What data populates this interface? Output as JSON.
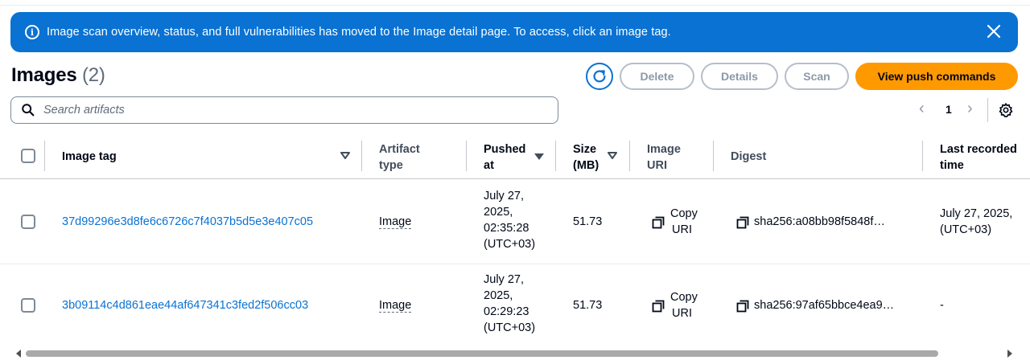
{
  "banner": {
    "message": "Image scan overview, status, and full vulnerabilities has moved to the Image detail page. To access, click an image tag.",
    "info_icon": "info-icon",
    "close_icon": "close-icon",
    "color": "#0972d3"
  },
  "header": {
    "title": "Images",
    "count": "(2)"
  },
  "actions": {
    "refresh_icon": "refresh-icon",
    "delete_label": "Delete",
    "details_label": "Details",
    "scan_label": "Scan",
    "push_label": "View push commands",
    "primary_color": "#ff9900"
  },
  "search": {
    "placeholder": "Search artifacts",
    "value": ""
  },
  "pagination": {
    "current_page": "1",
    "prev_icon": "chevron-left-icon",
    "next_icon": "chevron-right-icon",
    "settings_icon": "gear-icon"
  },
  "table": {
    "columns": {
      "image_tag": "Image tag",
      "artifact_type_1": "Artifact",
      "artifact_type_2": "type",
      "pushed_at_1": "Pushed",
      "pushed_at_2": "at",
      "size_1": "Size",
      "size_2": "(MB)",
      "image_uri_1": "Image",
      "image_uri_2": "URI",
      "digest": "Digest",
      "last_recorded_1": "Last recorded",
      "last_recorded_2": "time"
    },
    "rows": [
      {
        "image_tag": "37d99296e3d8fe6c6726c7f4037b5d5e3e407c05",
        "artifact_type": "Image",
        "pushed_1": "July 27,",
        "pushed_2": "2025,",
        "pushed_3": "02:35:28",
        "pushed_4": "(UTC+03)",
        "size": "51.73",
        "copy_1": "Copy",
        "copy_2": "URI",
        "digest": "sha256:a08bb98f5848f…",
        "last_recorded_1": "July 27, 2025,",
        "last_recorded_2": "(UTC+03)"
      },
      {
        "image_tag": "3b09114c4d861eae44af647341c3fed2f506cc03",
        "artifact_type": "Image",
        "pushed_1": "July 27,",
        "pushed_2": "2025,",
        "pushed_3": "02:29:23",
        "pushed_4": "(UTC+03)",
        "size": "51.73",
        "copy_1": "Copy",
        "copy_2": "URI",
        "digest": "sha256:97af65bbce4ea9…",
        "last_recorded_1": "-",
        "last_recorded_2": ""
      }
    ]
  }
}
